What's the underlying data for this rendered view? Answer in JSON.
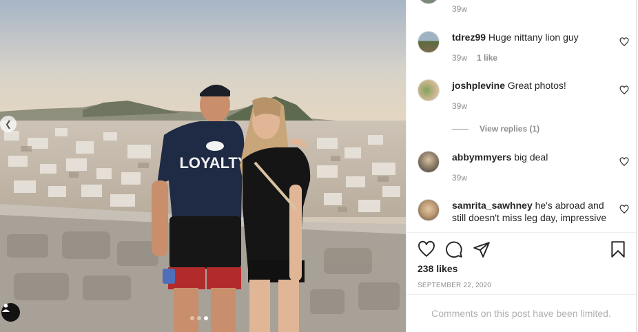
{
  "photo": {
    "shirt_text": "LOYALTY",
    "carousel_dots": [
      false,
      false,
      true
    ]
  },
  "comments": [
    {
      "username": "",
      "text": "",
      "time": "39w",
      "likes": ""
    },
    {
      "username": "tdrez99",
      "text": "Huge nittany lion guy",
      "time": "39w",
      "likes": "1 like"
    },
    {
      "username": "joshplevine",
      "text": "Great photos!",
      "time": "39w",
      "likes": ""
    },
    {
      "username": "abbymmyers",
      "text": "big deal",
      "time": "39w",
      "likes": ""
    },
    {
      "username": "samrita_sawhney",
      "text": "he's abroad and still doesn't miss leg day, impressive",
      "time": "",
      "likes": ""
    }
  ],
  "view_replies": "View replies (1)",
  "likes_count": "238 likes",
  "post_date": "SEPTEMBER 22, 2020",
  "comments_limited": "Comments on this post have been limited.",
  "icons": {
    "like": "heart-icon",
    "comment": "comment-bubble-icon",
    "share": "paper-plane-icon",
    "save": "bookmark-icon",
    "comment_like": "small-heart-icon",
    "prev": "chevron-left-icon",
    "tag": "user-tag-icon"
  }
}
